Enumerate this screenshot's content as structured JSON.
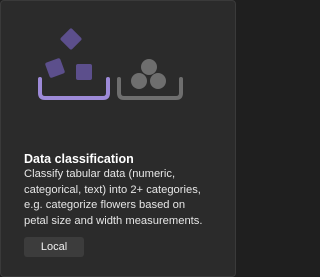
{
  "card": {
    "title": "Data classification",
    "description_lines": [
      "Classify tabular data (numeric,",
      "categorical, text) into 2+ categories,",
      "e.g. categorize flowers based on",
      "petal size and width measurements."
    ],
    "tag_label": "Local",
    "illustration": {
      "left_icon": "sorting-shapes-icon",
      "right_icon": "grouped-circles-icon",
      "accent_color": "#9d8ad8",
      "accent_dark_color": "#5c4f8c",
      "muted_color": "#6e6e6e"
    }
  }
}
